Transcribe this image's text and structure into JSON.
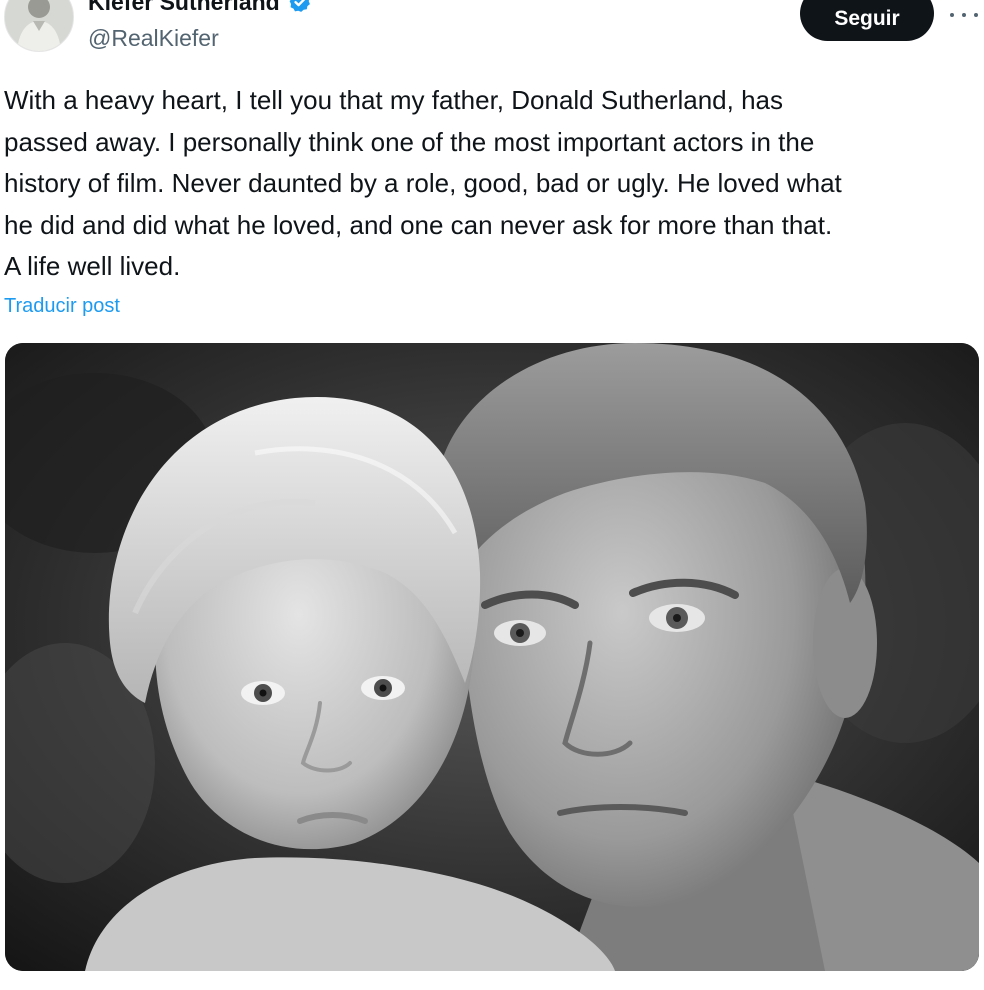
{
  "post": {
    "author": {
      "display_name": "Kiefer Sutherland",
      "handle": "@RealKiefer",
      "verified": true,
      "verified_icon": "verified-badge-icon",
      "avatar_icon": "avatar-photo"
    },
    "follow_label": "Seguir",
    "more_icon": "more-options-icon",
    "text": "With a heavy heart, I tell you that my father, Donald Sutherland, has\npassed away. I personally think one of the most important actors in the\nhistory of film. Never daunted by a role, good, bad or ugly. He loved what\nhe did and did what he loved, and one can never ask for more than that.\nA life well lived.",
    "translate_label": "Traducir post",
    "media": {
      "type": "black-and-white photo",
      "icon": "photo-image"
    }
  },
  "colors": {
    "text": "#0f1419",
    "secondary_text": "#536471",
    "link": "#1d9bf0",
    "verified": "#1d9bf0",
    "follow_button_bg": "#0f1419",
    "follow_button_text": "#ffffff"
  }
}
